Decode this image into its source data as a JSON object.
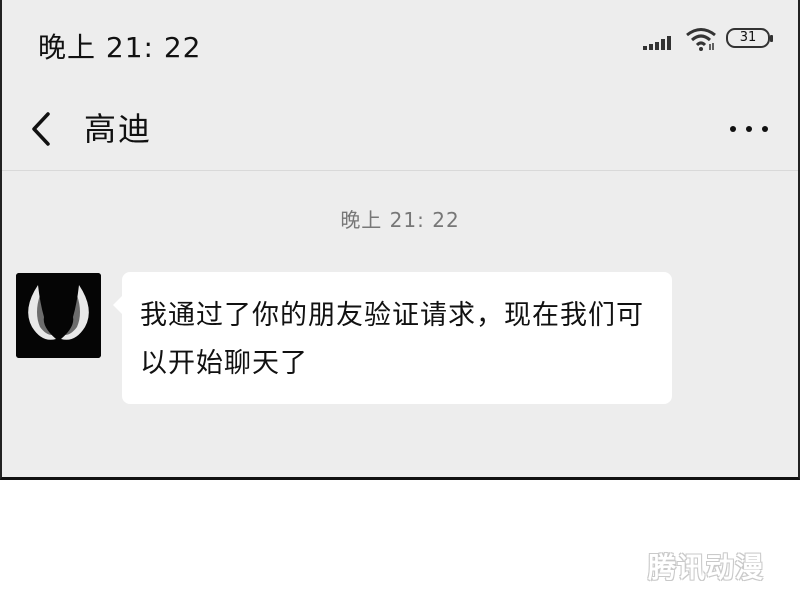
{
  "status_bar": {
    "time": "晚上  21: 22",
    "battery": "31",
    "icons": [
      "signal-icon",
      "wifi-icon",
      "battery-icon"
    ]
  },
  "nav": {
    "back_icon": "chevron-left-icon",
    "title": "高迪",
    "more_icon": "more-dots-icon"
  },
  "chat": {
    "timestamp": "晚上  21: 22",
    "messages": [
      {
        "sender": "高迪",
        "avatar_icon": "venom-eyes-avatar",
        "text": "我通过了你的朋友验证请求，现在我们可以开始聊天了"
      }
    ]
  },
  "watermark": "腾讯动漫",
  "colors": {
    "background": "#ededed",
    "bubble": "#ffffff",
    "timestamp": "#777777",
    "text": "#111111"
  }
}
